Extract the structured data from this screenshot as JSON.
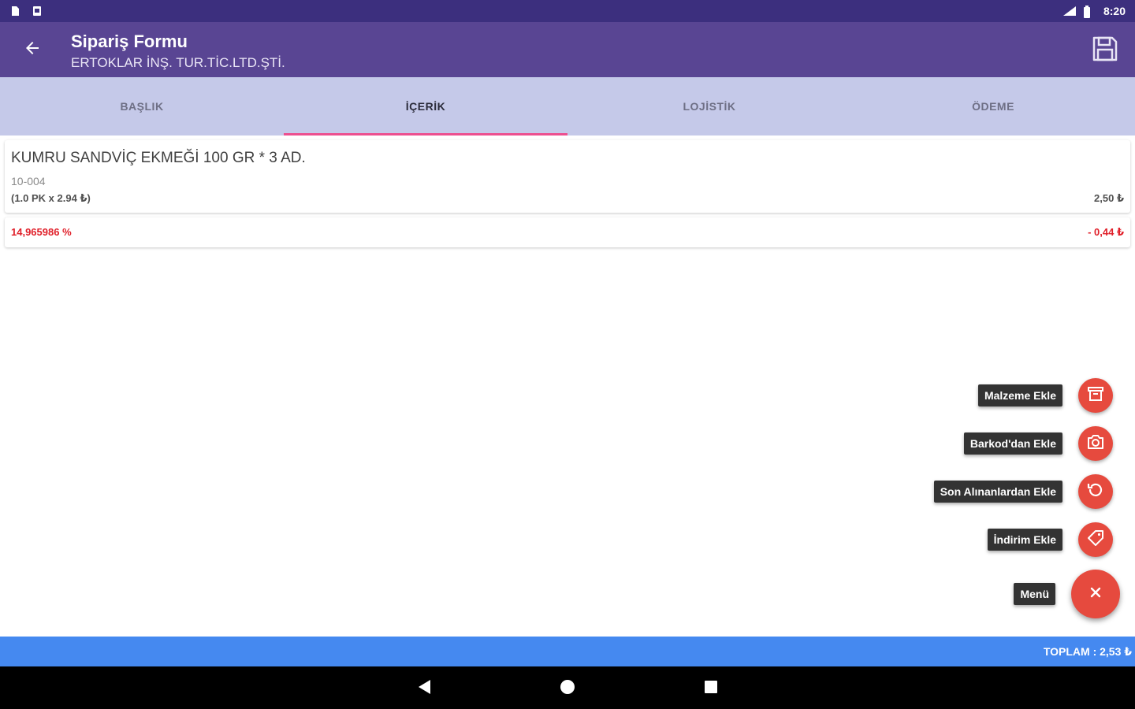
{
  "status_bar": {
    "time": "8:20"
  },
  "app_bar": {
    "title": "Sipariş Formu",
    "subtitle": "ERTOKLAR İNŞ. TUR.TİC.LTD.ŞTİ."
  },
  "tabs": [
    {
      "label": "BAŞLIK",
      "active": false
    },
    {
      "label": "İÇERİK",
      "active": true
    },
    {
      "label": "LOJİSTİK",
      "active": false
    },
    {
      "label": "ÖDEME",
      "active": false
    }
  ],
  "item": {
    "name": "KUMRU SANDVİÇ EKMEĞİ 100 GR * 3 AD.",
    "code": "10-004",
    "quantity": "(1.0 PK x 2.94 ₺)",
    "price": "2,50 ₺"
  },
  "discount": {
    "rate": "14,965986 %",
    "amount": "- 0,44 ₺"
  },
  "fab_menu": {
    "items": [
      {
        "label": "Malzeme Ekle",
        "icon": "archive-icon"
      },
      {
        "label": "Barkod'dan Ekle",
        "icon": "camera-icon"
      },
      {
        "label": "Son Alınanlardan Ekle",
        "icon": "history-icon"
      },
      {
        "label": "İndirim Ekle",
        "icon": "tag-icon"
      }
    ],
    "main_label": "Menü",
    "main_icon": "close-icon"
  },
  "total": {
    "text": "TOPLAM : 2,53 ₺"
  },
  "colors": {
    "primary": "#594593",
    "status_bar": "#3c2f7e",
    "tab_bar": "#c5c9e9",
    "tab_indicator": "#ec4f8f",
    "fab": "#e64a3e",
    "total_bar": "#4589f0",
    "discount_text": "#e0202a"
  }
}
